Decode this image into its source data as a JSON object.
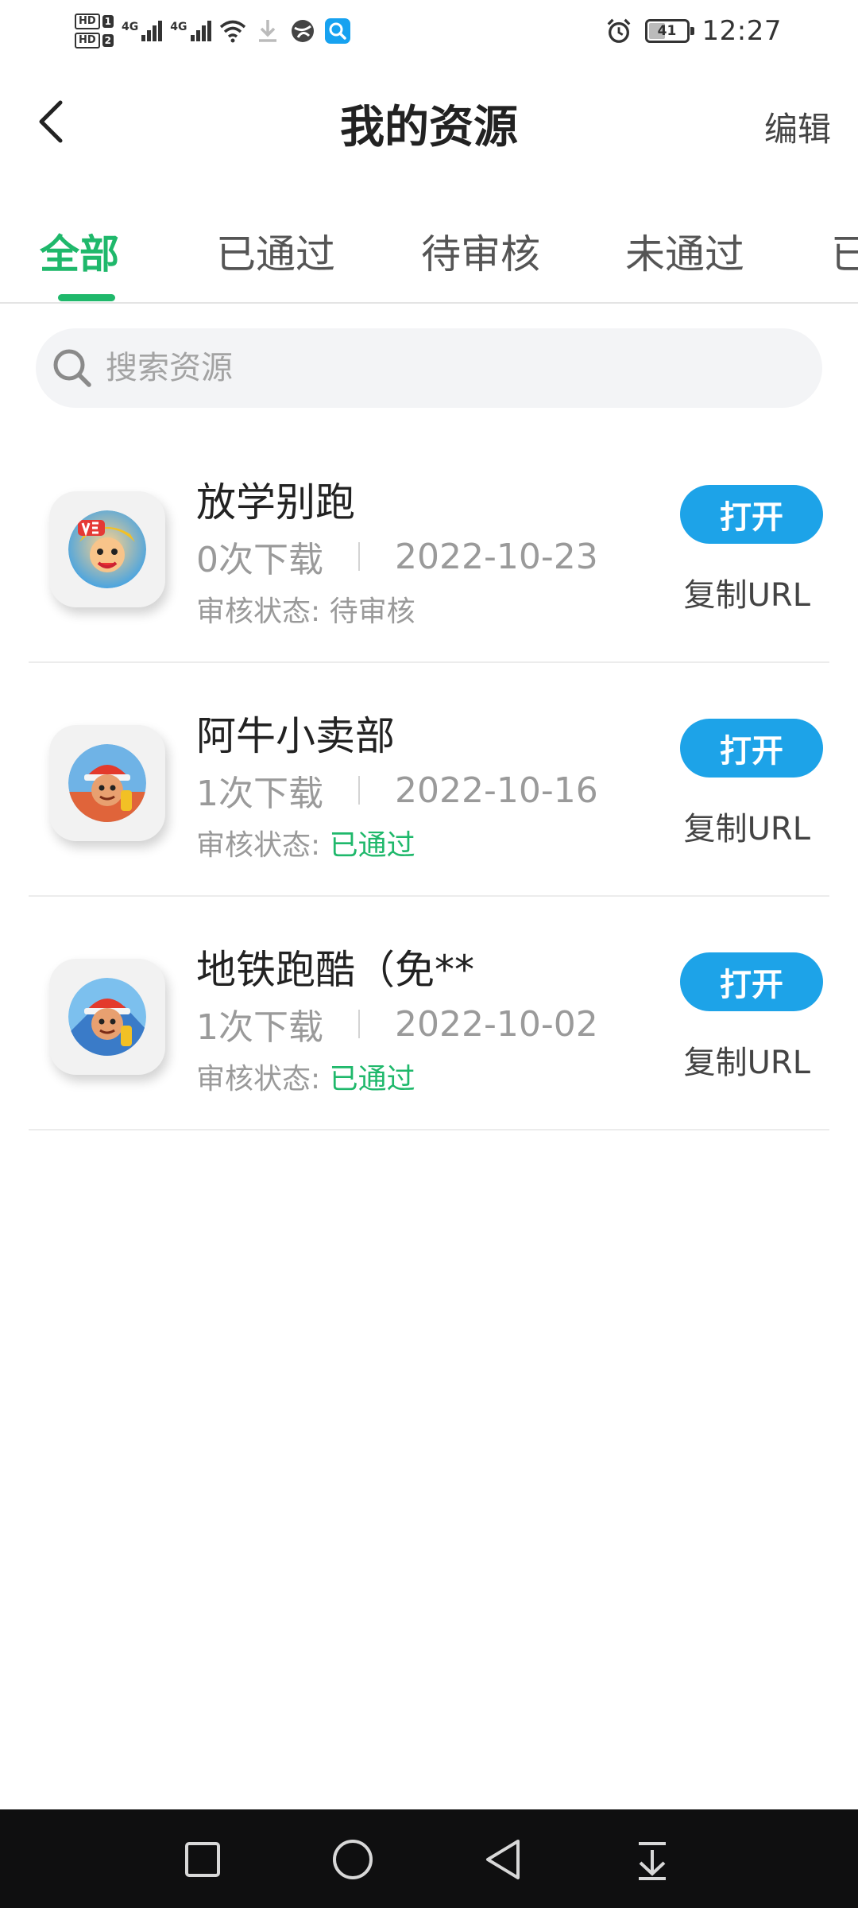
{
  "status_bar": {
    "hd1": "HD",
    "hd1_num": "1",
    "hd2": "HD",
    "hd2_num": "2",
    "sim1_network": "4G",
    "sim2_network": "4G",
    "battery": "41",
    "time": "12:27"
  },
  "header": {
    "title": "我的资源",
    "edit_label": "编辑"
  },
  "tabs": [
    {
      "label": "全部",
      "active": true
    },
    {
      "label": "已通过",
      "active": false
    },
    {
      "label": "待审核",
      "active": false
    },
    {
      "label": "未通过",
      "active": false
    },
    {
      "label": "已",
      "active": false
    }
  ],
  "search": {
    "placeholder": "搜索资源",
    "value": ""
  },
  "resources": [
    {
      "name": "放学别跑",
      "downloads": "0次下载",
      "date": "2022-10-23",
      "status_label": "审核状态:",
      "status_value": "待审核",
      "status_color": "#9a9a9a",
      "icon": "game-icon-fangxuebiepao",
      "open_label": "打开",
      "copy_label": "复制URL"
    },
    {
      "name": "阿牛小卖部",
      "downloads": "1次下载",
      "date": "2022-10-16",
      "status_label": "审核状态:",
      "status_value": "已通过",
      "status_color": "#1fb86b",
      "icon": "game-icon-subway-runner",
      "open_label": "打开",
      "copy_label": "复制URL"
    },
    {
      "name": "地铁跑酷（免**",
      "downloads": "1次下载",
      "date": "2022-10-02",
      "status_label": "审核状态:",
      "status_value": "已通过",
      "status_color": "#1fb86b",
      "icon": "game-icon-subway-runner",
      "open_label": "打开",
      "copy_label": "复制URL"
    }
  ],
  "colors": {
    "accent_green": "#1fb86b",
    "button_blue": "#1da3e8",
    "navbar": "#0f0f10"
  },
  "navbar": {
    "icons": [
      "square-icon",
      "circle-home-icon",
      "back-triangle-icon",
      "download-arrow-icon"
    ]
  }
}
